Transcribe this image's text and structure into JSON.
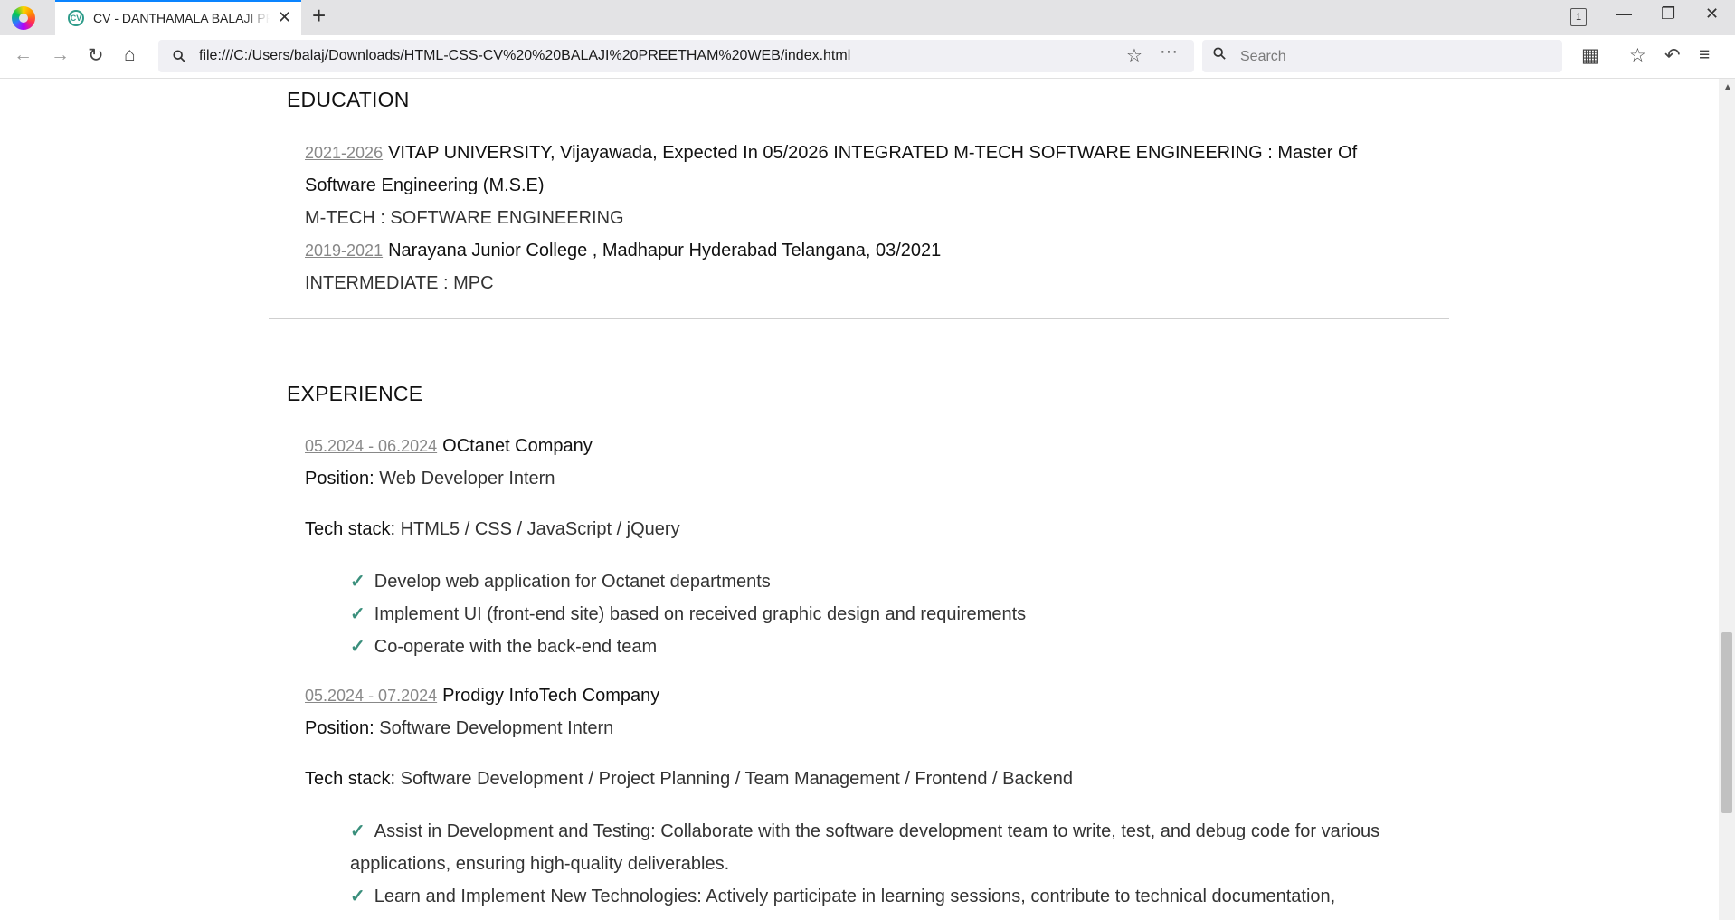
{
  "browser": {
    "tab_title": "CV - DANTHAMALA BALAJI PREETHAM",
    "tab_favicon_text": "CV",
    "tabs_count": "1",
    "url": "file:///C:/Users/balaj/Downloads/HTML-CSS-CV%20%20BALAJI%20PREETHAM%20WEB/index.html",
    "search_placeholder": "Search"
  },
  "education": {
    "title": "EDUCATION",
    "entries": [
      {
        "date": "2021-2026",
        "institution_line1": "VITAP UNIVERSITY, Vijayawada, Expected In 05/2026 INTEGRATED M-TECH SOFTWARE ENGINEERING : Master Of",
        "institution_line2": "Software Engineering (M.S.E)",
        "detail": "M-TECH : SOFTWARE ENGINEERING"
      },
      {
        "date": "2019-2021",
        "institution_line1": "Narayana Junior College , Madhapur Hyderabad Telangana, 03/2021",
        "detail": "INTERMEDIATE : MPC"
      }
    ]
  },
  "experience": {
    "title": "EXPERIENCE",
    "jobs": [
      {
        "date": "05.2024 - 06.2024",
        "company": "OCtanet Company",
        "position_label": "Position:",
        "position": "Web Developer Intern",
        "stack_label": "Tech stack:",
        "stack": "HTML5 / CSS / JavaScript / jQuery",
        "tasks": [
          "Develop web application for Octanet departments",
          "Implement UI (front-end site) based on received graphic design and requirements",
          "Co-operate with the back-end team"
        ]
      },
      {
        "date": "05.2024 - 07.2024",
        "company": "Prodigy InfoTech Company",
        "position_label": "Position:",
        "position": "Software Development Intern",
        "stack_label": "Tech stack:",
        "stack": "Software Development / Project Planning / Team Management / Frontend / Backend",
        "tasks": [
          "Assist in Development and Testing: Collaborate with the software development team to write, test, and debug code for various applications, ensuring high-quality deliverables.",
          "Learn and Implement New Technologies: Actively participate in learning sessions, contribute to technical documentation,"
        ]
      }
    ]
  },
  "colors": {
    "accent": "#0a84ff",
    "check": "#3a8f7c",
    "date": "#888888"
  }
}
